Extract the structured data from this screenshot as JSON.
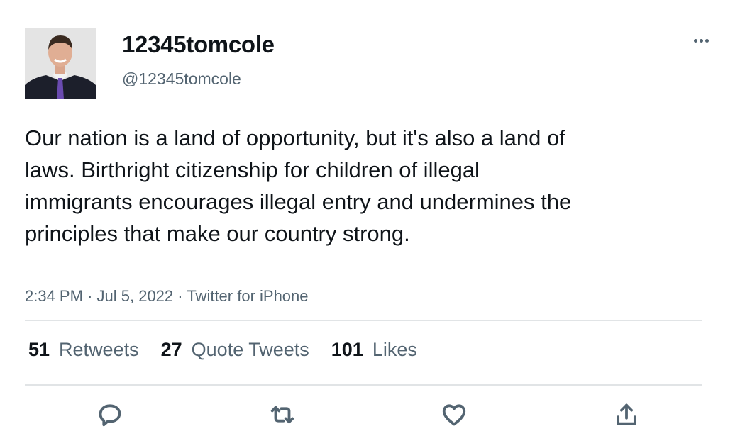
{
  "user": {
    "display_name": "12345tomcole",
    "handle": "@12345tomcole"
  },
  "tweet": {
    "text": "Our nation is a land of opportunity, but it's also a land of laws. Birthright citizenship for children of illegal immigrants encourages illegal entry and undermines the principles that make our country strong.",
    "time": "2:34 PM",
    "date": "Jul 5, 2022",
    "source": "Twitter for iPhone",
    "separator": "·"
  },
  "stats": {
    "retweets_count": "51",
    "retweets_label": "Retweets",
    "quotes_count": "27",
    "quotes_label": "Quote Tweets",
    "likes_count": "101",
    "likes_label": "Likes"
  },
  "actions": [
    "reply-icon",
    "retweet-icon",
    "like-icon",
    "share-icon"
  ],
  "colors": {
    "text_primary": "#0f1419",
    "text_secondary": "#536471",
    "divider": "#e1e4e6"
  }
}
